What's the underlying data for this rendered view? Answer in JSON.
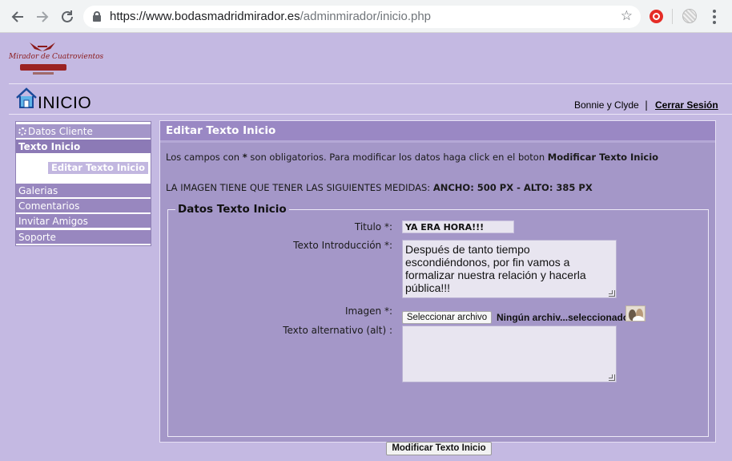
{
  "browser": {
    "url_domain": "https://www.bodasmadridmirador.es",
    "url_path": "/adminmirador/inicio.php",
    "icons": [
      "back-arrow-icon",
      "forward-arrow-icon",
      "reload-icon",
      "lock-icon",
      "bookmark-star-icon",
      "extension-icon",
      "profile-icon",
      "kebab-menu-icon"
    ]
  },
  "logo": {
    "name": "Mirador de Cuatrovientos"
  },
  "header": {
    "title": "INICIO",
    "user_name": "Bonnie y Clyde",
    "separator": "|",
    "logout_label": "Cerrar Sesión"
  },
  "sidebar": {
    "items": [
      {
        "label": "Datos Cliente",
        "icon": "gear-icon"
      },
      {
        "label": "Texto Inicio"
      },
      {
        "label": "Editar Texto Inicio"
      },
      {
        "label": "Galerias"
      },
      {
        "label": "Comentarios"
      },
      {
        "label": "Invitar Amigos"
      },
      {
        "label": "Soporte"
      }
    ]
  },
  "main": {
    "title": "Editar Texto Inicio",
    "info1_prefix": "Los campos con ",
    "info1_star": "*",
    "info1_middle": " son obligatorios. Para modificar los datos haga click en el boton ",
    "info1_bold": "Modificar Texto Inicio",
    "info2_prefix": "LA IMAGEN TIENE QUE TENER LAS SIGUIENTES MEDIDAS: ",
    "info2_bold": "ANCHO: 500 PX - ALTO: 385 PX",
    "fieldset_legend": "Datos Texto Inicio",
    "titulo_label": "Titulo *:",
    "titulo_value": "YA ERA HORA!!!",
    "intro_label": "Texto Introducción *:",
    "intro_value": "Después de tanto tiempo escondiéndonos, por fin vamos a formalizar nuestra relación y hacerla pública!!!",
    "imagen_label": "Imagen *:",
    "file_button": "Seleccionar archivo",
    "file_status": "Ningún archiv...seleccionado",
    "alt_label": "Texto alternativo (alt) :",
    "alt_value": "",
    "submit_label": "Modificar Texto Inicio"
  },
  "colors": {
    "page_bg": "#c4b9e2",
    "panel_bg": "#a497c8",
    "header_bg": "#9a88c4",
    "sidebar_item_bg": "#9887bf"
  }
}
